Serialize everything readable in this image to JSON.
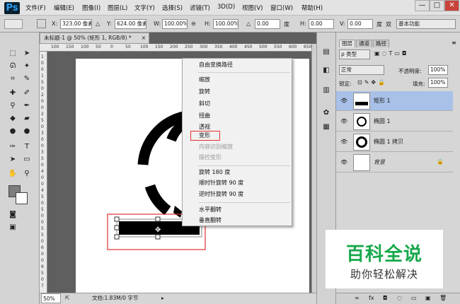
{
  "app": {
    "logo": "Ps"
  },
  "menubar": {
    "items": [
      "文件(F)",
      "编辑(E)",
      "图像(I)",
      "图层(L)",
      "文字(Y)",
      "选择(S)",
      "滤镜(T)",
      "3D(D)",
      "视图(V)",
      "窗口(W)",
      "帮助(H)"
    ],
    "window_buttons": [
      "—",
      "□",
      "✕"
    ]
  },
  "options": {
    "x_label": "X:",
    "x_value": "323.00 像素",
    "delta": "△",
    "y_label": "Y:",
    "y_value": "624.00 像素",
    "w_label": "W:",
    "w_value": "100.00%",
    "link": "⊖",
    "h_label": "H:",
    "h_value": "100.00%",
    "angle_label": "△",
    "angle_value": "0.00",
    "deg": "度",
    "hskew_label": "H:",
    "hskew_value": "0.00",
    "vskew_label": "V:",
    "vskew_value": "0.00",
    "deg2": "度",
    "interp": "双",
    "workspace": "基本功能"
  },
  "document": {
    "tab_title": "未标题-1 @ 50% (矩形 1, RGB/8) *",
    "tab_close": "×",
    "ruler_top": [
      "100",
      "150",
      "100",
      "50",
      "0",
      "50",
      "100",
      "150",
      "200",
      "250",
      "300",
      "350",
      "400",
      "450",
      "500",
      "550",
      "600",
      "650",
      "700"
    ],
    "ruler_left": [
      "1",
      "0",
      "0",
      "1",
      "5",
      "0",
      "2",
      "0",
      "0",
      "2",
      "5",
      "0",
      "3",
      "0",
      "0",
      "3",
      "5",
      "0",
      "4",
      "0",
      "0",
      "4",
      "5",
      "0",
      "5",
      "0",
      "0",
      "5",
      "5",
      "0",
      "6",
      "0",
      "0",
      "6",
      "5",
      "0",
      "7"
    ],
    "zoom": "50%",
    "doc_info": "文档:1.83M/0 字节"
  },
  "context_menu": {
    "items": [
      {
        "label": "自由变换路径",
        "disabled": false
      },
      {
        "label": "缩放",
        "disabled": false
      },
      {
        "label": "旋转",
        "disabled": false
      },
      {
        "label": "斜切",
        "disabled": false
      },
      {
        "label": "扭曲",
        "disabled": false
      },
      {
        "label": "透视",
        "disabled": false
      },
      {
        "label": "变形",
        "disabled": false
      },
      {
        "label": "内容识别缩放",
        "disabled": true
      },
      {
        "label": "操控变形",
        "disabled": true
      },
      {
        "label": "旋转 180 度",
        "disabled": false
      },
      {
        "label": "顺时针旋转 90 度",
        "disabled": false
      },
      {
        "label": "逆时针旋转 90 度",
        "disabled": false
      },
      {
        "label": "水平翻转",
        "disabled": false
      },
      {
        "label": "垂直翻转",
        "disabled": false
      }
    ],
    "highlight_color": "#e03030"
  },
  "layers_panel": {
    "tabs": [
      "图层",
      "通道",
      "路径"
    ],
    "filter": "ρ 类型",
    "blend_mode": "正常",
    "opacity_label": "不透明度:",
    "opacity_value": "100%",
    "lock_label": "锁定:",
    "fill_label": "填充:",
    "fill_value": "100%",
    "layers": [
      {
        "name": "矩形 1",
        "selected": true
      },
      {
        "name": "椭圆 1",
        "selected": false
      },
      {
        "name": "椭圆 1 拷贝",
        "selected": false
      },
      {
        "name": "背景",
        "selected": false,
        "locked": true
      }
    ],
    "selected_color": "#a9c1e8",
    "footer_icons": [
      "∞",
      "fx",
      "◘",
      "◌",
      "▭",
      "▣",
      "🗑"
    ]
  },
  "watermark": {
    "title": "百科全说",
    "subtitle": "助你轻松解决",
    "color": "#17a84c"
  }
}
